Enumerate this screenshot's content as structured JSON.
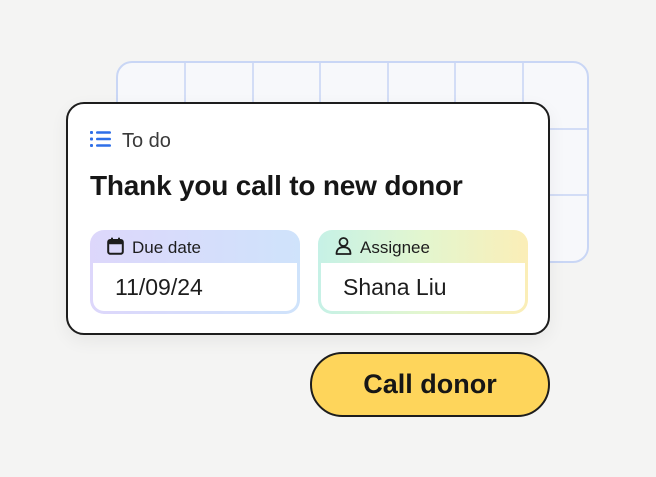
{
  "card": {
    "category_icon": "list-icon",
    "category_label": "To do",
    "title": "Thank you call to new donor",
    "due_date": {
      "icon": "calendar-icon",
      "label": "Due date",
      "value": "11/09/24"
    },
    "assignee": {
      "icon": "person-icon",
      "label": "Assignee",
      "value": "Shana Liu"
    }
  },
  "action": {
    "label": "Call donor"
  },
  "colors": {
    "accent_blue": "#2f6fe8",
    "button_yellow": "#fed55b",
    "grid_blue": "#c9d6f5"
  }
}
